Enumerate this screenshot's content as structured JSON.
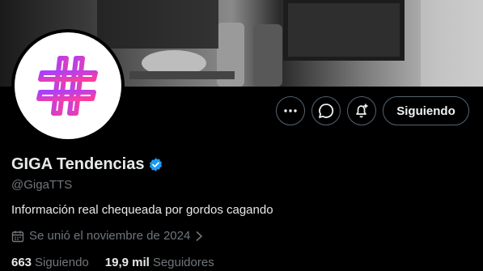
{
  "profile": {
    "display_name": "GIGA Tendencias",
    "handle": "@GigaTTS",
    "bio": "Información real chequeada por gordos cagando",
    "joined": "Se unió el noviembre de 2024",
    "following_count": "663",
    "following_label": "Siguiendo",
    "followers_count": "19,9 mil",
    "followers_label": "Seguidores",
    "verified": true
  },
  "actions": {
    "follow_label": "Siguiendo"
  },
  "icons": {
    "more": "more-icon",
    "message": "message-icon",
    "notify": "bell-plus-icon",
    "verified": "verified-badge-icon",
    "calendar": "calendar-icon",
    "avatar_logo": "hashtag-logo"
  },
  "colors": {
    "background": "#000000",
    "verified": "#1d9bf0",
    "secondary_text": "#71767b",
    "logo_gradient_start": "#a640ff",
    "logo_gradient_end": "#ff3d9a"
  }
}
